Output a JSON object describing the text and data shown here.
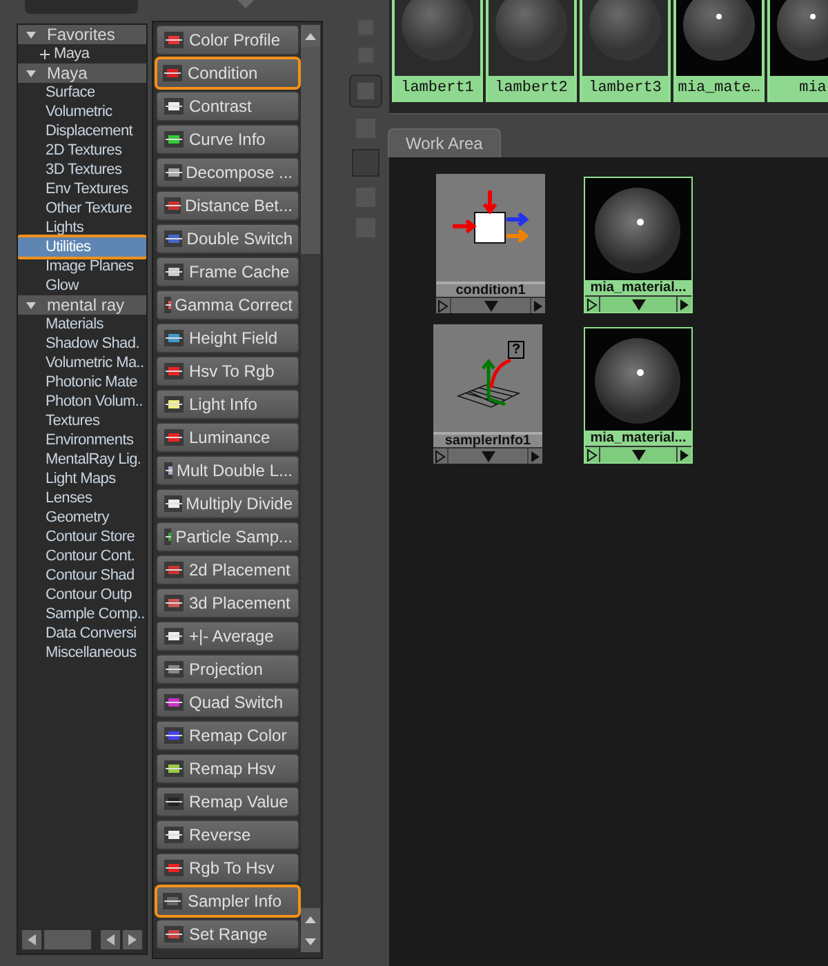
{
  "tree": [
    {
      "label": "Favorites",
      "expanded": true,
      "children": [
        {
          "label": "Maya",
          "expanded": false,
          "selected": false
        }
      ]
    },
    {
      "label": "Maya",
      "expanded": true,
      "children": [
        {
          "label": "Surface",
          "selected": false
        },
        {
          "label": "Volumetric",
          "selected": false
        },
        {
          "label": "Displacement",
          "selected": false
        },
        {
          "label": "2D Textures",
          "selected": false
        },
        {
          "label": "3D Textures",
          "selected": false
        },
        {
          "label": "Env Textures",
          "selected": false
        },
        {
          "label": "Other Texture",
          "selected": false
        },
        {
          "label": "Lights",
          "selected": false
        },
        {
          "label": "Utilities",
          "selected": true
        },
        {
          "label": "Image Planes",
          "selected": false
        },
        {
          "label": "Glow",
          "selected": false
        }
      ]
    },
    {
      "label": "mental ray",
      "expanded": true,
      "children": [
        {
          "label": "Materials",
          "selected": false
        },
        {
          "label": "Shadow Shad.",
          "selected": false
        },
        {
          "label": "Volumetric Ma..",
          "selected": false
        },
        {
          "label": "Photonic Mate",
          "selected": false
        },
        {
          "label": "Photon Volum..",
          "selected": false
        },
        {
          "label": "Textures",
          "selected": false
        },
        {
          "label": "Environments",
          "selected": false
        },
        {
          "label": "MentalRay Lig.",
          "selected": false
        },
        {
          "label": "Light Maps",
          "selected": false
        },
        {
          "label": "Lenses",
          "selected": false
        },
        {
          "label": "Geometry",
          "selected": false
        },
        {
          "label": "Contour Store",
          "selected": false
        },
        {
          "label": "Contour Cont.",
          "selected": false
        },
        {
          "label": "Contour Shad",
          "selected": false
        },
        {
          "label": "Contour Outp",
          "selected": false
        },
        {
          "label": "Sample Comp..",
          "selected": false
        },
        {
          "label": "Data Conversi",
          "selected": false
        },
        {
          "label": "Miscellaneous",
          "selected": false
        }
      ]
    }
  ],
  "node_buttons": [
    {
      "label": "Color Profile",
      "selected": false
    },
    {
      "label": "Condition",
      "selected": true
    },
    {
      "label": "Contrast",
      "selected": false
    },
    {
      "label": "Curve Info",
      "selected": false
    },
    {
      "label": "Decompose ...",
      "selected": false
    },
    {
      "label": "Distance Bet...",
      "selected": false
    },
    {
      "label": "Double Switch",
      "selected": false
    },
    {
      "label": "Frame Cache",
      "selected": false
    },
    {
      "label": "Gamma Correct",
      "selected": false
    },
    {
      "label": "Height Field",
      "selected": false
    },
    {
      "label": "Hsv To Rgb",
      "selected": false
    },
    {
      "label": "Light Info",
      "selected": false
    },
    {
      "label": "Luminance",
      "selected": false
    },
    {
      "label": "Mult Double L...",
      "selected": false
    },
    {
      "label": "Multiply Divide",
      "selected": false
    },
    {
      "label": "Particle Samp...",
      "selected": false
    },
    {
      "label": "2d Placement",
      "selected": false
    },
    {
      "label": "3d Placement",
      "selected": false
    },
    {
      "label": "+|- Average",
      "selected": false
    },
    {
      "label": "Projection",
      "selected": false
    },
    {
      "label": "Quad Switch",
      "selected": false
    },
    {
      "label": "Remap Color",
      "selected": false
    },
    {
      "label": "Remap Hsv",
      "selected": false
    },
    {
      "label": "Remap Value",
      "selected": false
    },
    {
      "label": "Reverse",
      "selected": false
    },
    {
      "label": "Rgb To Hsv",
      "selected": false
    },
    {
      "label": "Sampler Info",
      "selected": true
    },
    {
      "label": "Set Range",
      "selected": false
    }
  ],
  "swatches": [
    {
      "label": "lambert1",
      "kind": "lambert"
    },
    {
      "label": "lambert2",
      "kind": "lambert"
    },
    {
      "label": "lambert3",
      "kind": "lambert"
    },
    {
      "label": "mia_mate…",
      "kind": "mia"
    },
    {
      "label": "mia",
      "kind": "mia"
    }
  ],
  "work_area": {
    "tab": "Work Area",
    "nodes": [
      {
        "label": "condition1",
        "kind": "condition"
      },
      {
        "label": "mia_material...",
        "kind": "material"
      },
      {
        "label": "samplerInfo1",
        "kind": "sampler",
        "badge": "?"
      },
      {
        "label": "mia_material...",
        "kind": "material"
      }
    ]
  }
}
